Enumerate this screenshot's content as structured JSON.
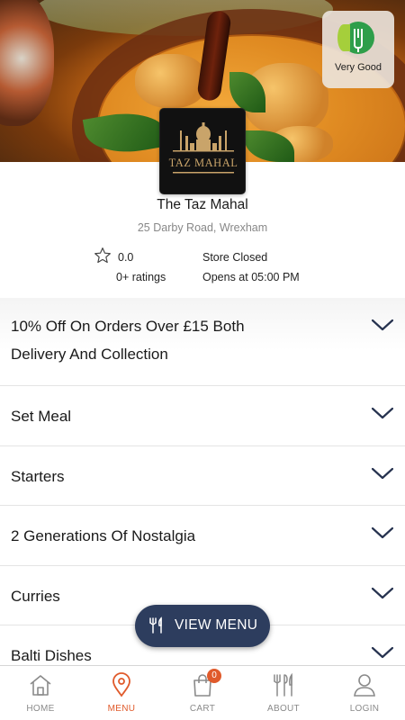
{
  "hero": {
    "rating_badge": {
      "label": "Very Good",
      "icon": "hygiene-rating-icon"
    }
  },
  "restaurant": {
    "logo_text": "TAZ MAHAL",
    "name": "The Taz Mahal",
    "address": "25 Darby Road, Wrexham",
    "rating_value": "0.0",
    "rating_count": "0+ ratings",
    "store_status": "Store Closed",
    "opening_time": "Opens at 05:00 PM"
  },
  "categories": [
    {
      "label": "10% Off On Orders Over £15 Both Delivery And Collection"
    },
    {
      "label": "Set Meal"
    },
    {
      "label": "Starters"
    },
    {
      "label": "2 Generations Of Nostalgia"
    },
    {
      "label": "Curries"
    },
    {
      "label": "Balti Dishes"
    }
  ],
  "view_menu": {
    "label": "VIEW MENU",
    "icon": "cutlery-icon"
  },
  "nav": {
    "items": [
      {
        "label": "HOME",
        "icon": "home-icon"
      },
      {
        "label": "MENU",
        "icon": "location-pin-icon",
        "active": true
      },
      {
        "label": "CART",
        "icon": "shopping-bag-icon",
        "badge": "0"
      },
      {
        "label": "ABOUT",
        "icon": "cutlery-icon"
      },
      {
        "label": "LOGIN",
        "icon": "user-icon"
      }
    ]
  },
  "colors": {
    "accent": "#e05a2b",
    "button_bg": "#2d3d5e",
    "chevron": "#26324f",
    "nav_text": "#8a8a8a"
  }
}
